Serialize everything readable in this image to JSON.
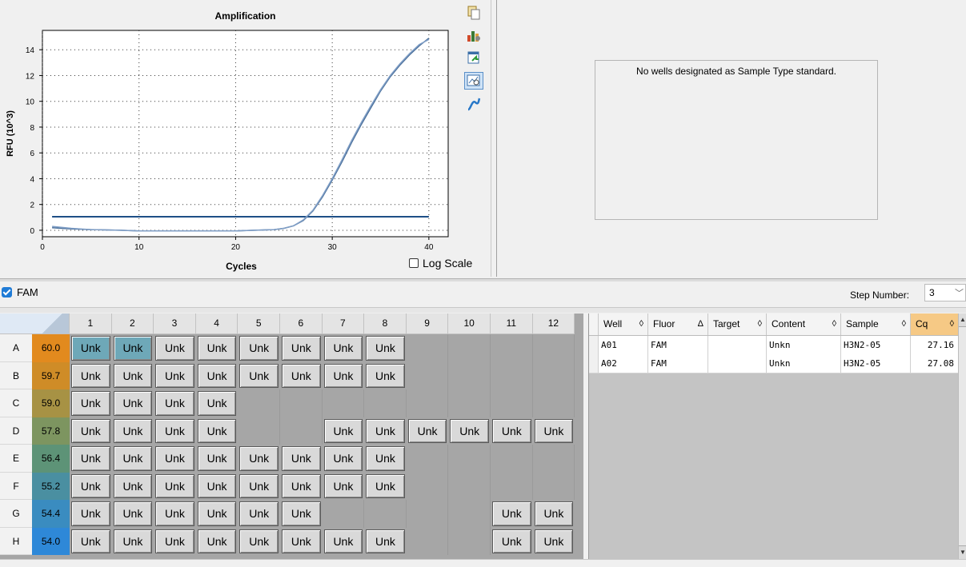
{
  "chart": {
    "title": "Amplification",
    "xlabel": "Cycles",
    "ylabel": "RFU (10^3)",
    "log_scale_label": "Log Scale",
    "log_scale_checked": false
  },
  "chart_data": {
    "type": "line",
    "title": "Amplification",
    "xlabel": "Cycles",
    "ylabel": "RFU (10^3)",
    "xlim": [
      0,
      42
    ],
    "ylim": [
      -0.5,
      15.5
    ],
    "xticks": [
      0,
      10,
      20,
      30,
      40
    ],
    "yticks": [
      0,
      2,
      4,
      6,
      8,
      10,
      12,
      14
    ],
    "grid": true,
    "threshold": 1.05,
    "series": [
      {
        "name": "A01",
        "color": "#4a6f9a",
        "x": [
          1,
          3,
          5,
          8,
          10,
          12,
          15,
          18,
          20,
          22,
          24,
          25,
          26,
          27,
          28,
          29,
          30,
          31,
          32,
          33,
          34,
          35,
          36,
          37,
          38,
          39,
          40
        ],
        "y": [
          0.2,
          0.1,
          0.05,
          0.0,
          -0.05,
          -0.05,
          -0.05,
          -0.05,
          -0.05,
          0.0,
          0.05,
          0.15,
          0.35,
          0.75,
          1.5,
          2.6,
          3.9,
          5.3,
          6.8,
          8.2,
          9.5,
          10.8,
          11.9,
          12.8,
          13.6,
          14.3,
          14.9
        ]
      },
      {
        "name": "A02",
        "color": "#7f9ec6",
        "x": [
          1,
          3,
          5,
          8,
          10,
          12,
          15,
          18,
          20,
          22,
          24,
          25,
          26,
          27,
          28,
          29,
          30,
          31,
          32,
          33,
          34,
          35,
          36,
          37,
          38,
          39,
          40
        ],
        "y": [
          0.3,
          0.15,
          0.05,
          0.0,
          -0.05,
          -0.05,
          -0.05,
          -0.05,
          -0.05,
          0.0,
          0.05,
          0.15,
          0.35,
          0.8,
          1.55,
          2.7,
          4.0,
          5.45,
          6.95,
          8.35,
          9.65,
          10.9,
          12.0,
          12.9,
          13.7,
          14.4,
          14.8
        ]
      }
    ]
  },
  "std": {
    "message": "No wells designated as Sample Type standard."
  },
  "fluor": {
    "label": "FAM",
    "checked": true
  },
  "step": {
    "label": "Step Number:",
    "value": "3"
  },
  "plate": {
    "cols": [
      "1",
      "2",
      "3",
      "4",
      "5",
      "6",
      "7",
      "8",
      "9",
      "10",
      "11",
      "12"
    ],
    "rows": [
      {
        "label": "A",
        "temp": "60.0",
        "temp_color": "#e28a1e",
        "wells": [
          "Unk",
          "Unk",
          "Unk",
          "Unk",
          "Unk",
          "Unk",
          "Unk",
          "Unk",
          "",
          "",
          "",
          ""
        ],
        "selected": [
          0,
          1
        ]
      },
      {
        "label": "B",
        "temp": "59.7",
        "temp_color": "#cf8c27",
        "wells": [
          "Unk",
          "Unk",
          "Unk",
          "Unk",
          "Unk",
          "Unk",
          "Unk",
          "Unk",
          "",
          "",
          "",
          ""
        ],
        "selected": []
      },
      {
        "label": "C",
        "temp": "59.0",
        "temp_color": "#a79244",
        "wells": [
          "Unk",
          "Unk",
          "Unk",
          "Unk",
          "",
          "",
          "",
          "",
          "",
          "",
          "",
          ""
        ],
        "selected": []
      },
      {
        "label": "D",
        "temp": "57.8",
        "temp_color": "#7d9560",
        "wells": [
          "Unk",
          "Unk",
          "Unk",
          "Unk",
          "",
          "",
          "Unk",
          "Unk",
          "Unk",
          "Unk",
          "Unk",
          "Unk"
        ],
        "selected": []
      },
      {
        "label": "E",
        "temp": "56.4",
        "temp_color": "#5d9377",
        "wells": [
          "Unk",
          "Unk",
          "Unk",
          "Unk",
          "Unk",
          "Unk",
          "Unk",
          "Unk",
          "",
          "",
          "",
          ""
        ],
        "selected": []
      },
      {
        "label": "F",
        "temp": "55.2",
        "temp_color": "#4a8fa1",
        "wells": [
          "Unk",
          "Unk",
          "Unk",
          "Unk",
          "Unk",
          "Unk",
          "Unk",
          "Unk",
          "",
          "",
          "",
          ""
        ],
        "selected": []
      },
      {
        "label": "G",
        "temp": "54.4",
        "temp_color": "#3a8cc0",
        "wells": [
          "Unk",
          "Unk",
          "Unk",
          "Unk",
          "Unk",
          "Unk",
          "",
          "",
          "",
          "",
          "Unk",
          "Unk"
        ],
        "selected": []
      },
      {
        "label": "H",
        "temp": "54.0",
        "temp_color": "#2e88d8",
        "wells": [
          "Unk",
          "Unk",
          "Unk",
          "Unk",
          "Unk",
          "Unk",
          "Unk",
          "Unk",
          "",
          "",
          "Unk",
          "Unk"
        ],
        "selected": []
      }
    ]
  },
  "table": {
    "headers": [
      {
        "label": "Well",
        "sort": "◊"
      },
      {
        "label": "Fluor",
        "sort": "Δ"
      },
      {
        "label": "Target",
        "sort": "◊"
      },
      {
        "label": "Content",
        "sort": "◊"
      },
      {
        "label": "Sample",
        "sort": "◊"
      },
      {
        "label": "Cq",
        "sort": "◊"
      }
    ],
    "rows": [
      [
        "A01",
        "FAM",
        "",
        "Unkn",
        "H3N2-05",
        "27.16"
      ],
      [
        "A02",
        "FAM",
        "",
        "Unkn",
        "H3N2-05",
        "27.08"
      ]
    ]
  },
  "toolbar_icons": [
    "copy-icon",
    "chart-settings-icon",
    "export-icon",
    "zoom-chart-icon",
    "curve-icon"
  ]
}
